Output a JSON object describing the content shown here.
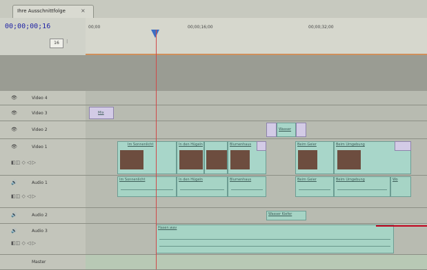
{
  "sequence_tab": {
    "label": "Ihre Ausschnittfolge",
    "close": "×"
  },
  "timecode": "00;00;00;16",
  "zoom_value": "16",
  "ruler": {
    "ticks": [
      "00;00",
      "00;00;16;00",
      "00;00;32;00"
    ]
  },
  "tracks": [
    {
      "name": "Video 4"
    },
    {
      "name": "Video 3"
    },
    {
      "name": "Video 2"
    },
    {
      "name": "Video 1"
    },
    {
      "name": "Audio 1"
    },
    {
      "name": "Audio 2"
    },
    {
      "name": "Audio 3"
    },
    {
      "name": "Master"
    }
  ],
  "clips": {
    "v1": [
      "Im Sonnenlicht",
      "In den Hügeln",
      "Blumenhaus",
      "Beim Geier",
      "Beim Umgebung"
    ],
    "a1": [
      "Im Sonnenlicht",
      "In den Hügeln",
      "Blumenhaus",
      "Beim Geier",
      "Beim Umgebung",
      "Wo"
    ],
    "v2": "Wasser",
    "a2": "Wasser Kiefer",
    "a3": "Hasen.wav",
    "v3": "Mix"
  },
  "colors": {
    "accent": "#1c1fa4",
    "playhead": "#3c6fc5",
    "clip": "#a8d6c9",
    "pointer": "#c2001b"
  }
}
